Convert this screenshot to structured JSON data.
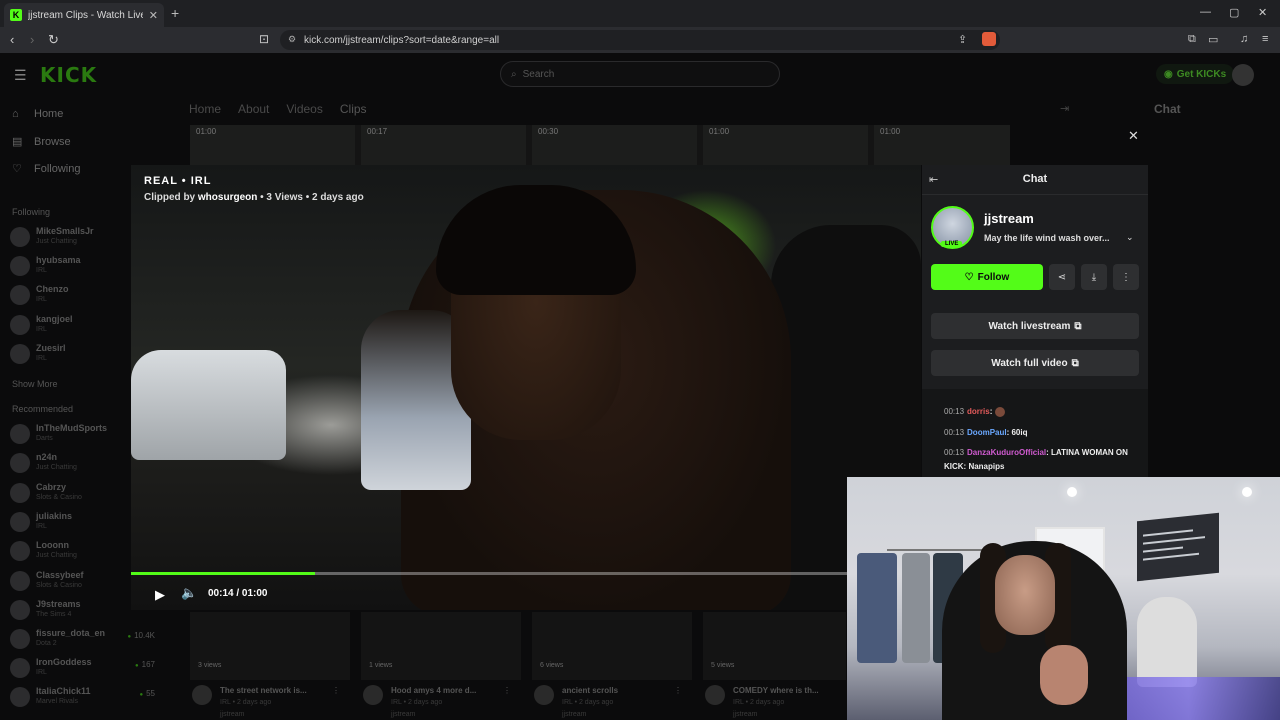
{
  "browser": {
    "tab_title": "jjstream Clips - Watch Live on Kick",
    "url": "kick.com/jjstream/clips?sort=date&range=all"
  },
  "header": {
    "logo": "KICK",
    "search_placeholder": "Search",
    "get_kicks": "Get KICKs"
  },
  "sidebar": {
    "nav": [
      {
        "label": "Home",
        "icon": "home-icon"
      },
      {
        "label": "Browse",
        "icon": "browse-icon"
      },
      {
        "label": "Following",
        "icon": "heart-icon"
      }
    ],
    "following_title": "Following",
    "following": [
      {
        "name": "MikeSmallsJr",
        "category": "Just Chatting"
      },
      {
        "name": "hyubsama",
        "category": "IRL"
      },
      {
        "name": "Chenzo",
        "category": "IRL"
      },
      {
        "name": "kangjoel",
        "category": "IRL"
      },
      {
        "name": "Zuesirl",
        "category": "IRL"
      }
    ],
    "show_more": "Show More",
    "recommended_title": "Recommended",
    "recommended": [
      {
        "name": "InTheMudSports",
        "category": "Darts",
        "viewers": ""
      },
      {
        "name": "n24n",
        "category": "Just Chatting",
        "viewers": ""
      },
      {
        "name": "Cabrzy",
        "category": "Slots & Casino",
        "viewers": ""
      },
      {
        "name": "juliakins",
        "category": "IRL",
        "viewers": ""
      },
      {
        "name": "Looonn",
        "category": "Just Chatting",
        "viewers": ""
      },
      {
        "name": "Classybeef",
        "category": "Slots & Casino",
        "viewers": ""
      },
      {
        "name": "J9streams",
        "category": "The Sims 4",
        "viewers": ""
      },
      {
        "name": "fissure_dota_en",
        "category": "Dota 2",
        "viewers": "10.4K"
      },
      {
        "name": "IronGoddess",
        "category": "IRL",
        "viewers": "167"
      },
      {
        "name": "ItaliaChick11",
        "category": "Marvel Rivals",
        "viewers": "55"
      }
    ]
  },
  "channel_tabs": [
    "Home",
    "About",
    "Videos",
    "Clips"
  ],
  "bg_thumbs": [
    "01:00",
    "00:17",
    "00:30",
    "01:00",
    "01:00"
  ],
  "bg_chat": {
    "title": "Chat"
  },
  "clip": {
    "title": "REAL • IRL",
    "clipped_by_prefix": "Clipped by",
    "clipper": "whosurgeon",
    "views": "3 Views",
    "age": "2 days ago",
    "time_display": "00:14 / 01:00",
    "progress": 0.2333
  },
  "panel": {
    "title": "Chat",
    "channel_name": "jjstream",
    "live_badge": "LIVE",
    "stream_title": "May the life wind wash over...",
    "follow_label": "Follow",
    "watch_livestream": "Watch livestream",
    "watch_full_video": "Watch full video",
    "accent_color": "#53fc18",
    "messages": [
      {
        "time": "00:13",
        "user": "dorris",
        "user_color": "#e45b5b",
        "text": ""
      },
      {
        "time": "00:13",
        "user": "DoomPaul",
        "user_color": "#6aa8ff",
        "text": "60iq"
      },
      {
        "time": "00:13",
        "user": "DanzaKuduroOfficial",
        "user_color": "#d05bd0",
        "text": "LATINA WOMAN ON KICK: Nanapips"
      }
    ]
  },
  "bottom_clips": [
    {
      "views": "3 views",
      "title": "The street network is...",
      "meta": "IRL • 2 days ago",
      "channel": "jjstream"
    },
    {
      "views": "1 views",
      "title": "Hood amys 4 more d...",
      "meta": "IRL • 2 days ago",
      "channel": "jjstream"
    },
    {
      "views": "6 views",
      "title": "ancient scrolls",
      "meta": "IRL • 2 days ago",
      "channel": "jjstream"
    },
    {
      "views": "5 views",
      "title": "COMEDY where is th...",
      "meta": "IRL • 2 days ago",
      "channel": "jjstream"
    }
  ]
}
